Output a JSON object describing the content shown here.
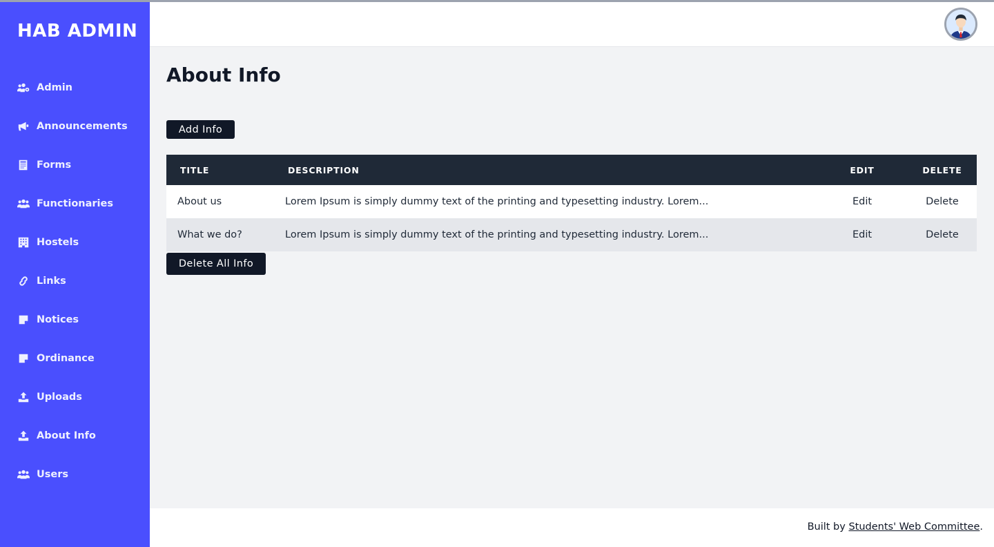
{
  "app": {
    "brand": "HAB ADMIN"
  },
  "sidebar": {
    "items": [
      {
        "label": "Admin",
        "icon": "users-cog-icon"
      },
      {
        "label": "Announcements",
        "icon": "bullhorn-icon"
      },
      {
        "label": "Forms",
        "icon": "form-icon"
      },
      {
        "label": "Functionaries",
        "icon": "users-icon"
      },
      {
        "label": "Hostels",
        "icon": "building-icon"
      },
      {
        "label": "Links",
        "icon": "link-icon"
      },
      {
        "label": "Notices",
        "icon": "sticky-note-icon"
      },
      {
        "label": "Ordinance",
        "icon": "sticky-note-icon"
      },
      {
        "label": "Uploads",
        "icon": "upload-icon"
      },
      {
        "label": "About Info",
        "icon": "upload-icon"
      },
      {
        "label": "Users",
        "icon": "users-icon"
      }
    ]
  },
  "header": {
    "avatar_icon": "user-avatar-icon"
  },
  "main": {
    "title": "About Info",
    "add_button": "Add Info",
    "delete_all_button": "Delete All Info",
    "table": {
      "headers": {
        "title": "TITLE",
        "description": "DESCRIPTION",
        "edit": "EDIT",
        "delete": "DELETE"
      },
      "rows": [
        {
          "title": "About us",
          "description": "Lorem Ipsum is simply dummy text of the printing and typesetting industry. Lorem...",
          "edit": "Edit",
          "delete": "Delete"
        },
        {
          "title": "What we do?",
          "description": "Lorem Ipsum is simply dummy text of the printing and typesetting industry. Lorem...",
          "edit": "Edit",
          "delete": "Delete"
        }
      ]
    }
  },
  "footer": {
    "prefix": "Built by ",
    "link": "Students' Web Committee",
    "suffix": "."
  },
  "colors": {
    "sidebar": "#4a4ffe",
    "dark": "#111827",
    "table_header": "#1f2937",
    "content_bg": "#f2f3f5"
  }
}
